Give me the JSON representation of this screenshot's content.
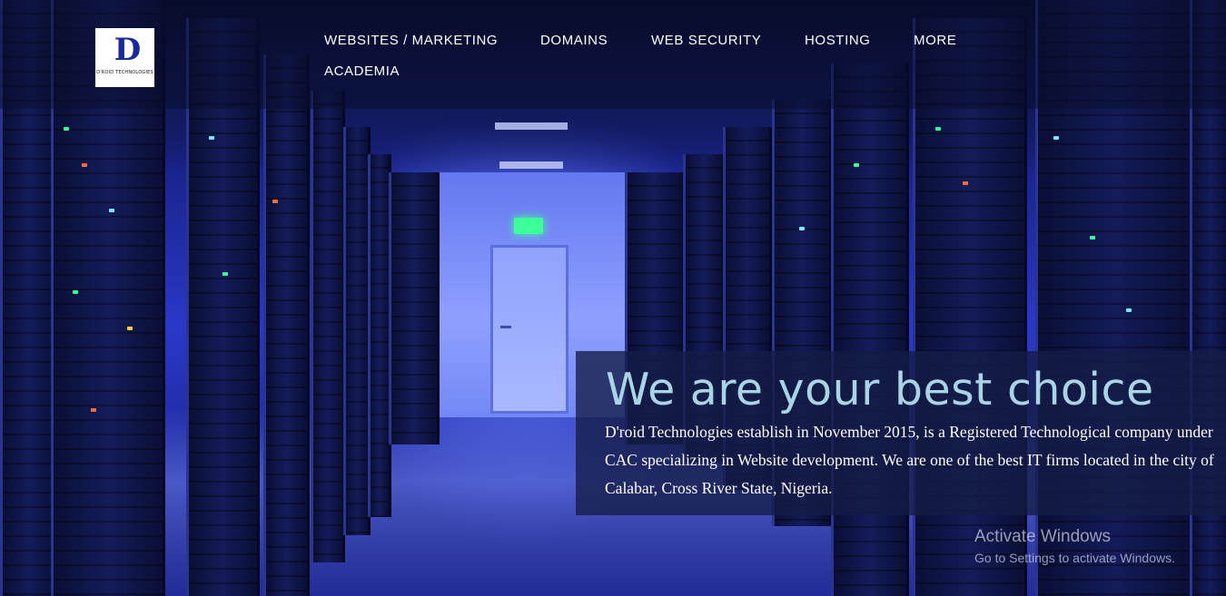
{
  "header": {
    "logo": {
      "mark": "D",
      "text": "D'ROID TECHNOLOGIES"
    },
    "nav": [
      {
        "label": "WEBSITES / MARKETING"
      },
      {
        "label": "DOMAINS"
      },
      {
        "label": "WEB SECURITY"
      },
      {
        "label": "HOSTING"
      },
      {
        "label": "MORE"
      },
      {
        "label": "ACADEMIA"
      }
    ]
  },
  "hero": {
    "title": "We are your best choice",
    "body": "D'roid Technologies establish in November 2015, is a Registered Technological company under CAC specializing in Website development. We are one of the best IT firms located in the city of Calabar, Cross River State, Nigeria."
  },
  "watermark": {
    "title": "Activate Windows",
    "subtitle": "Go to Settings to activate Windows."
  },
  "colors": {
    "title": "#a9d4e6",
    "panel": "#141c46",
    "nav_text": "#ffffff"
  }
}
